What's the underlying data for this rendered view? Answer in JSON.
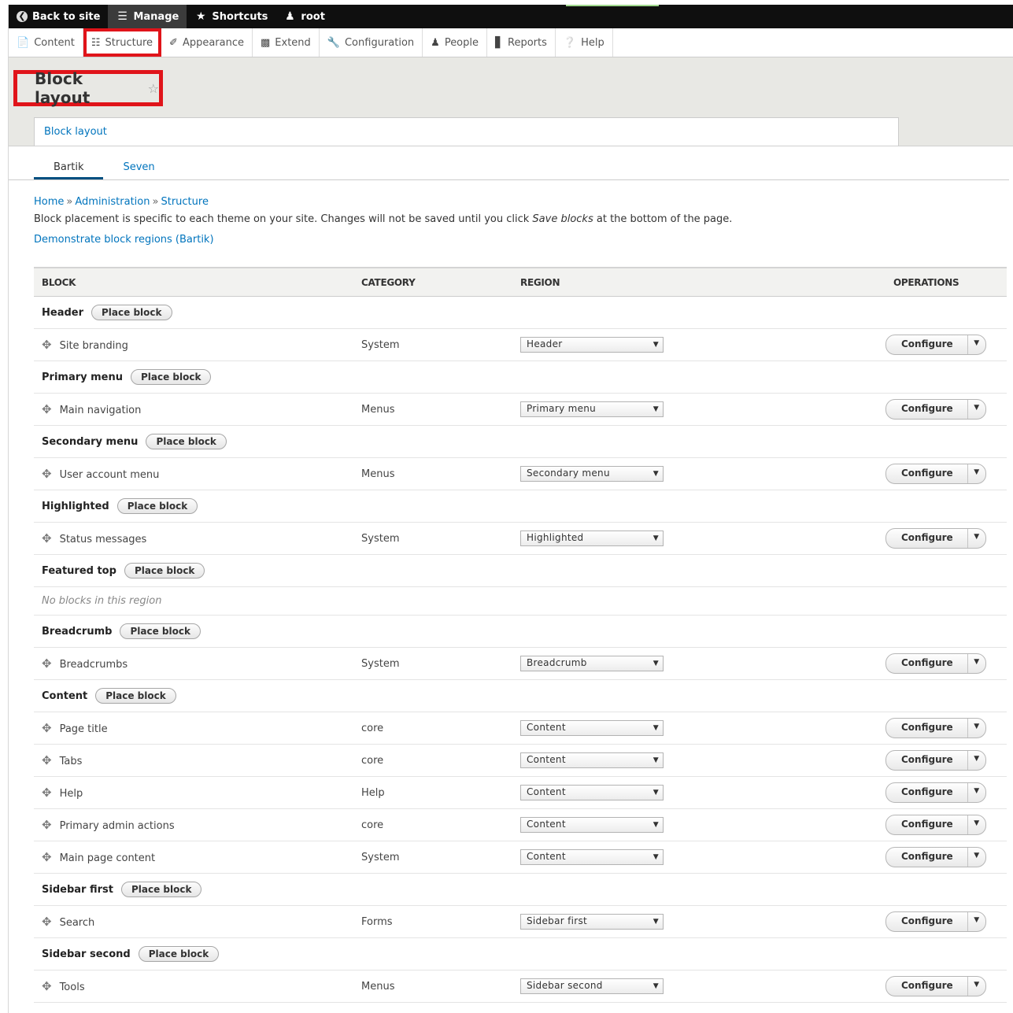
{
  "toolbar": {
    "back_label": "Back to site",
    "manage_label": "Manage",
    "shortcuts_label": "Shortcuts",
    "user_label": "root"
  },
  "tray": [
    {
      "label": "Content",
      "icon": "file-icon"
    },
    {
      "label": "Structure",
      "icon": "sitemap-icon"
    },
    {
      "label": "Appearance",
      "icon": "paintbrush-icon"
    },
    {
      "label": "Extend",
      "icon": "puzzle-icon"
    },
    {
      "label": "Configuration",
      "icon": "wrench-icon"
    },
    {
      "label": "People",
      "icon": "people-icon"
    },
    {
      "label": "Reports",
      "icon": "bar-chart-icon"
    },
    {
      "label": "Help",
      "icon": "help-icon"
    }
  ],
  "page": {
    "title": "Block layout",
    "primary_tab": "Block layout",
    "secondary_tabs": [
      "Bartik",
      "Seven"
    ],
    "breadcrumb": [
      "Home",
      "Administration",
      "Structure"
    ],
    "breadcrumb_sep": "»",
    "desc_before": "Block placement is specific to each theme on your site. Changes will not be saved until you click ",
    "desc_em": "Save blocks",
    "desc_after": " at the bottom of the page.",
    "demo_link": "Demonstrate block regions (Bartik)"
  },
  "table": {
    "headers": {
      "block": "BLOCK",
      "category": "CATEGORY",
      "region": "REGION",
      "operations": "OPERATIONS"
    },
    "place_label": "Place block",
    "configure_label": "Configure",
    "empty_label": "No blocks in this region",
    "regions": [
      {
        "name": "Header",
        "blocks": [
          {
            "name": "Site branding",
            "category": "System",
            "region": "Header"
          }
        ]
      },
      {
        "name": "Primary menu",
        "blocks": [
          {
            "name": "Main navigation",
            "category": "Menus",
            "region": "Primary menu"
          }
        ]
      },
      {
        "name": "Secondary menu",
        "blocks": [
          {
            "name": "User account menu",
            "category": "Menus",
            "region": "Secondary menu"
          }
        ]
      },
      {
        "name": "Highlighted",
        "blocks": [
          {
            "name": "Status messages",
            "category": "System",
            "region": "Highlighted"
          }
        ]
      },
      {
        "name": "Featured top",
        "blocks": []
      },
      {
        "name": "Breadcrumb",
        "blocks": [
          {
            "name": "Breadcrumbs",
            "category": "System",
            "region": "Breadcrumb"
          }
        ]
      },
      {
        "name": "Content",
        "blocks": [
          {
            "name": "Page title",
            "category": "core",
            "region": "Content"
          },
          {
            "name": "Tabs",
            "category": "core",
            "region": "Content"
          },
          {
            "name": "Help",
            "category": "Help",
            "region": "Content"
          },
          {
            "name": "Primary admin actions",
            "category": "core",
            "region": "Content"
          },
          {
            "name": "Main page content",
            "category": "System",
            "region": "Content"
          }
        ]
      },
      {
        "name": "Sidebar first",
        "blocks": [
          {
            "name": "Search",
            "category": "Forms",
            "region": "Sidebar first"
          }
        ]
      },
      {
        "name": "Sidebar second",
        "blocks": [
          {
            "name": "Tools",
            "category": "Menus",
            "region": "Sidebar second"
          }
        ]
      }
    ]
  },
  "colors": {
    "link": "#0074bd",
    "highlight": "#e0141a",
    "toolbar": "#0f0f0f"
  }
}
